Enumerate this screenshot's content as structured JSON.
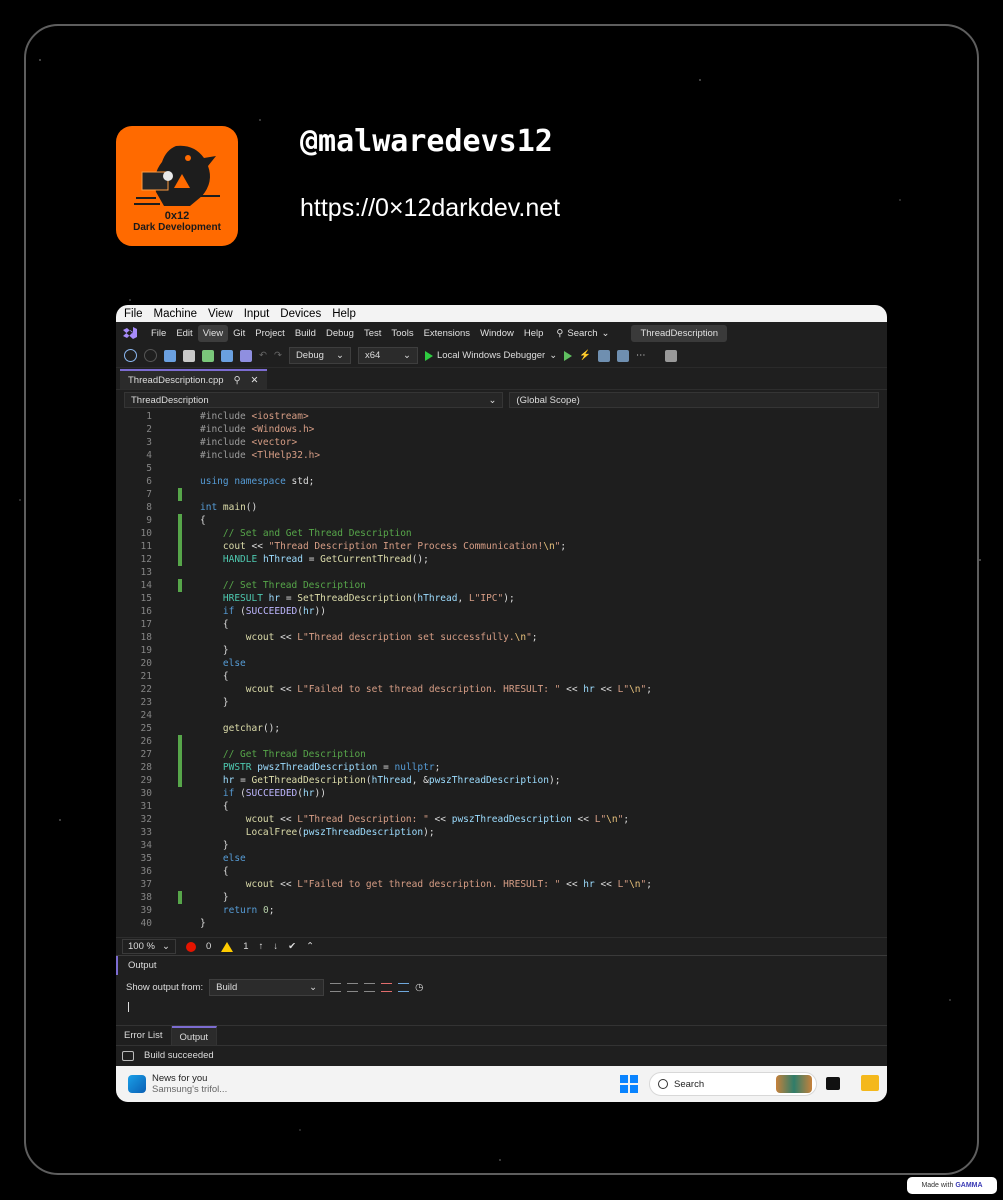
{
  "profile": {
    "handle": "@malwaredevs12",
    "url": "https://0×12darkdev.net",
    "logo_line1": "0x12",
    "logo_line2": "Dark Development"
  },
  "vbox_menu": [
    "File",
    "Machine",
    "View",
    "Input",
    "Devices",
    "Help"
  ],
  "vs_menu": [
    "File",
    "Edit",
    "View",
    "Git",
    "Project",
    "Build",
    "Debug",
    "Test",
    "Tools",
    "Extensions",
    "Window",
    "Help"
  ],
  "vs_search_label": "Search",
  "vs_title": "ThreadDescription",
  "toolbar": {
    "config": "Debug",
    "platform": "x64",
    "debugger": "Local Windows Debugger"
  },
  "tab": {
    "filename": "ThreadDescription.cpp"
  },
  "nav": {
    "project": "ThreadDescription",
    "scope": "(Global Scope)"
  },
  "code_lines": [
    {
      "n": "1",
      "html": "<span class='pp'>#include </span><span class='str'>&lt;iostream&gt;</span>"
    },
    {
      "n": "2",
      "html": "<span class='pp'>#include </span><span class='str'>&lt;Windows.h&gt;</span>"
    },
    {
      "n": "3",
      "html": "<span class='pp'>#include </span><span class='str'>&lt;vector&gt;</span>"
    },
    {
      "n": "4",
      "html": "<span class='pp'>#include </span><span class='str'>&lt;TlHelp32.h&gt;</span>"
    },
    {
      "n": "5",
      "html": ""
    },
    {
      "n": "6",
      "html": "<span class='kw'>using namespace</span> std;"
    },
    {
      "n": "7",
      "html": ""
    },
    {
      "n": "8",
      "html": "<span class='kw'>int</span> <span class='fn'>main</span>()"
    },
    {
      "n": "9",
      "html": "{"
    },
    {
      "n": "10",
      "html": "    <span class='cm'>// Set and Get Thread Description</span>"
    },
    {
      "n": "11",
      "html": "    <span class='fn'>cout</span> &lt;&lt; <span class='str'>\"Thread Description Inter Process Communication!</span><span class='esc'>\\n</span><span class='str'>\"</span>;"
    },
    {
      "n": "12",
      "html": "    <span class='ty'>HANDLE</span> <span class='vr'>hThread</span> = <span class='fn'>GetCurrentThread</span>();"
    },
    {
      "n": "13",
      "html": ""
    },
    {
      "n": "14",
      "html": "    <span class='cm'>// Set Thread Description</span>"
    },
    {
      "n": "15",
      "html": "    <span class='ty'>HRESULT</span> <span class='vr'>hr</span> = <span class='fn'>SetThreadDescription</span>(<span class='vr'>hThread</span>, <span class='str'>L\"IPC\"</span>);"
    },
    {
      "n": "16",
      "html": "    <span class='kw'>if</span> (<span class='mac'>SUCCEEDED</span>(<span class='vr'>hr</span>))"
    },
    {
      "n": "17",
      "html": "    {"
    },
    {
      "n": "18",
      "html": "        <span class='fn'>wcout</span> &lt;&lt; <span class='str'>L\"Thread description set successfully.</span><span class='esc'>\\n</span><span class='str'>\"</span>;"
    },
    {
      "n": "19",
      "html": "    }"
    },
    {
      "n": "20",
      "html": "    <span class='kw'>else</span>"
    },
    {
      "n": "21",
      "html": "    {"
    },
    {
      "n": "22",
      "html": "        <span class='fn'>wcout</span> &lt;&lt; <span class='str'>L\"Failed to set thread description. HRESULT: \"</span> &lt;&lt; <span class='vr'>hr</span> &lt;&lt; <span class='str'>L\"</span><span class='esc'>\\n</span><span class='str'>\"</span>;"
    },
    {
      "n": "23",
      "html": "    }"
    },
    {
      "n": "24",
      "html": ""
    },
    {
      "n": "25",
      "html": "    <span class='fn'>getchar</span>();"
    },
    {
      "n": "26",
      "html": ""
    },
    {
      "n": "27",
      "html": "    <span class='cm'>// Get Thread Description</span>"
    },
    {
      "n": "28",
      "html": "    <span class='ty'>PWSTR</span> <span class='vr'>pwszThreadDescription</span> = <span class='kw'>nullptr</span>;"
    },
    {
      "n": "29",
      "html": "    <span class='vr'>hr</span> = <span class='fn'>GetThreadDescription</span>(<span class='vr'>hThread</span>, &amp;<span class='vr'>pwszThreadDescription</span>);"
    },
    {
      "n": "30",
      "html": "    <span class='kw'>if</span> (<span class='mac'>SUCCEEDED</span>(<span class='vr'>hr</span>))"
    },
    {
      "n": "31",
      "html": "    {"
    },
    {
      "n": "32",
      "html": "        <span class='fn'>wcout</span> &lt;&lt; <span class='str'>L\"Thread Description: \"</span> &lt;&lt; <span class='vr'>pwszThreadDescription</span> &lt;&lt; <span class='str'>L\"</span><span class='esc'>\\n</span><span class='str'>\"</span>;"
    },
    {
      "n": "33",
      "html": "        <span class='fn'>LocalFree</span>(<span class='vr'>pwszThreadDescription</span>);"
    },
    {
      "n": "34",
      "html": "    }"
    },
    {
      "n": "35",
      "html": "    <span class='kw'>else</span>"
    },
    {
      "n": "36",
      "html": "    {"
    },
    {
      "n": "37",
      "html": "        <span class='fn'>wcout</span> &lt;&lt; <span class='str'>L\"Failed to get thread description. HRESULT: \"</span> &lt;&lt; <span class='vr'>hr</span> &lt;&lt; <span class='str'>L\"</span><span class='esc'>\\n</span><span class='str'>\"</span>;"
    },
    {
      "n": "38",
      "html": "    }"
    },
    {
      "n": "39",
      "html": "    <span class='kw'>return</span> <span class='num'>0</span>;"
    },
    {
      "n": "40",
      "html": "}"
    }
  ],
  "status": {
    "zoom": "100 %",
    "errors": "0",
    "warnings": "1"
  },
  "output": {
    "title": "Output",
    "show_label": "Show output from:",
    "source": "Build"
  },
  "bottom_tabs": [
    "Error List",
    "Output"
  ],
  "build_status": "Build succeeded",
  "taskbar": {
    "news_title": "News for you",
    "news_sub": "Samsung's trifol...",
    "search_label": "Search"
  },
  "badge": {
    "prefix": "Made with",
    "brand": "GAMMA"
  }
}
